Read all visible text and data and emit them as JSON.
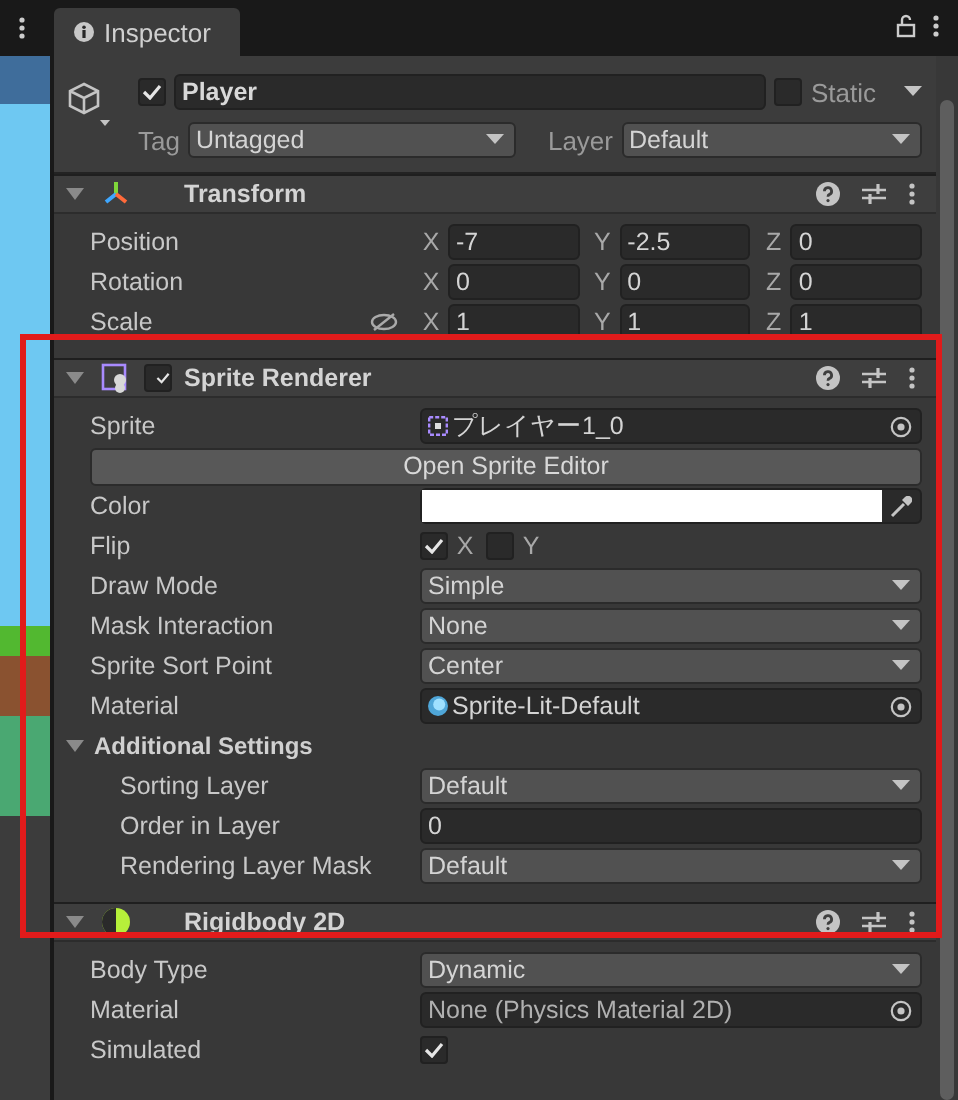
{
  "tab": {
    "title": "Inspector"
  },
  "object": {
    "active": true,
    "name": "Player",
    "static": false,
    "static_label": "Static",
    "tag_label": "Tag",
    "tag": "Untagged",
    "layer_label": "Layer",
    "layer": "Default"
  },
  "components": [
    {
      "kind": "transform",
      "title": "Transform",
      "expanded": true,
      "rows": [
        {
          "kind": "vector3",
          "label": "Position",
          "values": [
            {
              "axis": "X",
              "value": "-7"
            },
            {
              "axis": "Y",
              "value": "-2.5"
            },
            {
              "axis": "Z",
              "value": "0"
            }
          ]
        },
        {
          "kind": "vector3",
          "label": "Rotation",
          "values": [
            {
              "axis": "X",
              "value": "0"
            },
            {
              "axis": "Y",
              "value": "0"
            },
            {
              "axis": "Z",
              "value": "0"
            }
          ]
        },
        {
          "kind": "vector3",
          "label": "Scale",
          "proportions_locked": false,
          "values": [
            {
              "axis": "X",
              "value": "1"
            },
            {
              "axis": "Y",
              "value": "1"
            },
            {
              "axis": "Z",
              "value": "1"
            }
          ]
        }
      ]
    },
    {
      "kind": "sprite",
      "title": "Sprite Renderer",
      "enabled": true,
      "expanded": true,
      "highlighted": true,
      "rows": [
        {
          "kind": "sprite_field",
          "label": "Sprite",
          "value": "プレイヤー1_0"
        },
        {
          "kind": "button",
          "label": "Open Sprite Editor"
        },
        {
          "kind": "color",
          "label": "Color",
          "color": "#ffffff"
        },
        {
          "kind": "flip",
          "label": "Flip",
          "options": [
            {
              "label": "X",
              "checked": true
            },
            {
              "label": "Y",
              "checked": false
            }
          ]
        },
        {
          "kind": "dropdown",
          "label": "Draw Mode",
          "value": "Simple"
        },
        {
          "kind": "dropdown",
          "label": "Mask Interaction",
          "value": "None"
        },
        {
          "kind": "dropdown",
          "label": "Sprite Sort Point",
          "value": "Center"
        },
        {
          "kind": "material_field",
          "label": "Material",
          "value": "Sprite-Lit-Default"
        },
        {
          "kind": "foldout",
          "label": "Additional Settings",
          "expanded": true,
          "children": [
            {
              "kind": "dropdown",
              "label": "Sorting Layer",
              "value": "Default"
            },
            {
              "kind": "text",
              "label": "Order in Layer",
              "value": "0"
            },
            {
              "kind": "dropdown",
              "label": "Rendering Layer Mask",
              "value": "Default"
            }
          ]
        }
      ]
    },
    {
      "kind": "rigidbody",
      "title": "Rigidbody 2D",
      "expanded": true,
      "rows": [
        {
          "kind": "dropdown",
          "label": "Body Type",
          "value": "Dynamic"
        },
        {
          "kind": "empty_field",
          "label": "Material",
          "value": "None (Physics Material 2D)"
        },
        {
          "kind": "checkbox",
          "label": "Simulated",
          "checked": true
        }
      ]
    }
  ]
}
